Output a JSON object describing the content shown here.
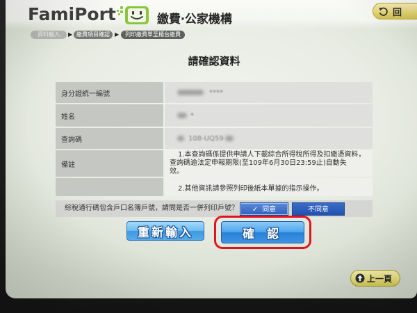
{
  "header": {
    "logo_text": "FamiPort",
    "title": "繳費‧公家機構",
    "home_label": "回"
  },
  "breadcrumb": {
    "steps": [
      "資料輸入",
      "繳費項目確認",
      "列印繳費單至櫃台繳費"
    ],
    "separator": "▶"
  },
  "main": {
    "heading": "請確認資料",
    "rows": [
      {
        "label": "身分證統一編號",
        "value": "****"
      },
      {
        "label": "姓名",
        "value": "*"
      },
      {
        "label": "查詢碼",
        "value": "108-UQ59"
      },
      {
        "label": "備註",
        "value_lines": [
          "1.本查詢碼係提供申請人下載綜合所得稅所得及扣繳憑資料，",
          "查詢碼逾法定申報期限(至109年6月30日23:59止)自動失",
          "效。"
        ]
      },
      {
        "value": "2.其他資訊請參照列印後紙本單據的指示操作。"
      }
    ],
    "question": {
      "text": "綜稅通行碼包含戶口名簿戶號，請問是否一併列印戶號？",
      "agree_check": "✓",
      "agree_label": "同意",
      "disagree_label": "不同意",
      "agree_selected": true
    }
  },
  "actions": {
    "reenter_label": "重新輸入",
    "confirm_label": "確 認"
  },
  "footer": {
    "back_label": "上一頁"
  },
  "icons": {
    "logo": "famiport-smiley-icon",
    "home": "home-arrow-icon",
    "check": "check-icon",
    "back": "up-arrow-icon"
  },
  "colors": {
    "brand_green": "#8cc63f",
    "button_blue": "#2f84dc",
    "highlight_red": "#e0141a",
    "back_yellow": "#e6dd73"
  }
}
